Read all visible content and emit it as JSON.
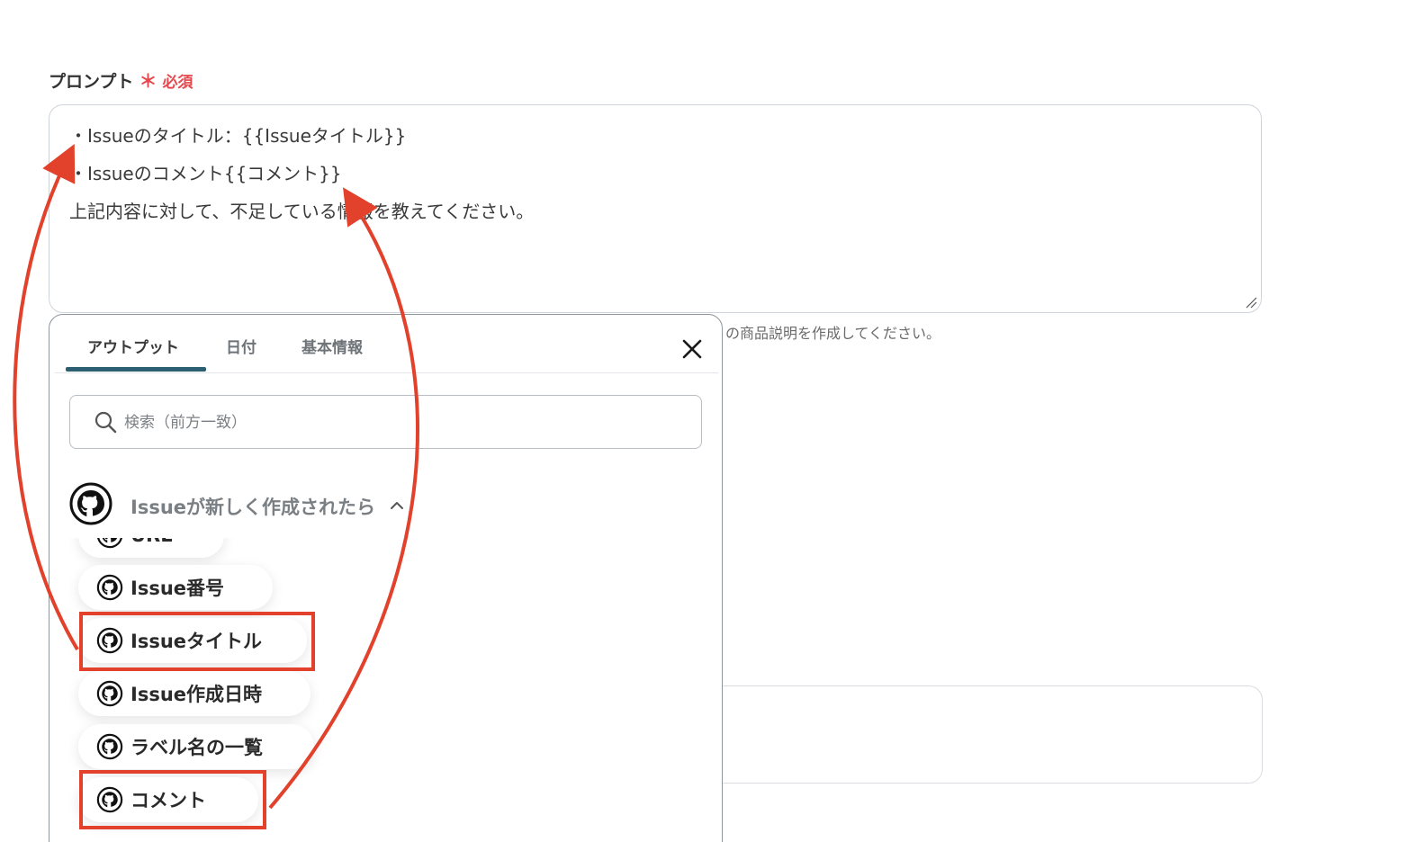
{
  "field": {
    "label": "プロンプト",
    "required_mark": "＊",
    "required_text": "必須"
  },
  "prompt": {
    "lines": [
      "・Issueのタイトル：{{Issueタイトル}}",
      "・Issueのコメント{{コメント}}",
      "上記内容に対して、不足している情報を教えてください。"
    ]
  },
  "helper_text": "の商品説明を作成してください。",
  "popover": {
    "tabs": [
      {
        "label": "アウトプット",
        "active": true
      },
      {
        "label": "日付",
        "active": false
      },
      {
        "label": "基本情報",
        "active": false
      }
    ],
    "search": {
      "placeholder": "検索（前方一致）",
      "value": ""
    },
    "group": {
      "title": "Issueが新しく作成されたら",
      "icon": "github-icon",
      "expanded": true
    },
    "items": [
      {
        "label": "URL",
        "icon": "github-icon"
      },
      {
        "label": "Issue番号",
        "icon": "github-icon"
      },
      {
        "label": "Issueタイトル",
        "icon": "github-icon",
        "highlighted": true
      },
      {
        "label": "Issue作成日時",
        "icon": "github-icon"
      },
      {
        "label": "ラベル名の一覧",
        "icon": "github-icon"
      },
      {
        "label": "コメント",
        "icon": "github-icon",
        "highlighted": true
      }
    ]
  },
  "colors": {
    "accent_tab": "#2d5f72",
    "required": "#e5484d",
    "annotation": "#e2412b"
  }
}
